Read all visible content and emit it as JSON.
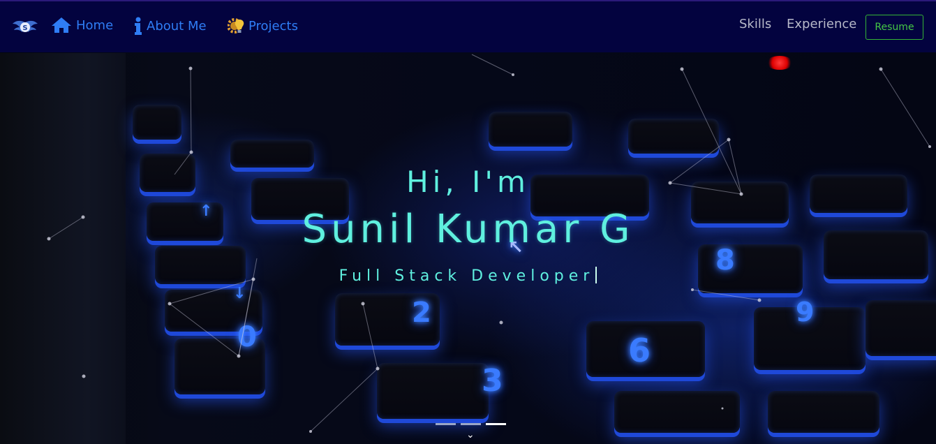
{
  "navbar": {
    "logo_icon": "winged-s-logo-icon",
    "items": [
      {
        "label": "Home",
        "icon": "home-icon"
      },
      {
        "label": "About Me",
        "icon": "info-icon"
      },
      {
        "label": "Projects",
        "icon": "lightbulb-gear-icon"
      }
    ],
    "right_items": [
      {
        "label": "Skills"
      },
      {
        "label": "Experience"
      }
    ],
    "resume_label": "Resume",
    "colors": {
      "background": "#03033f",
      "link": "#2f7df5",
      "resume": "#45c845"
    }
  },
  "hero": {
    "greeting": "Hi, I'm",
    "name": "Sunil Kumar G",
    "role": "Full Stack Developer",
    "text_color": "#5ff0df",
    "carousel": {
      "slides": 3,
      "active_index": 2
    },
    "scroll_icon": "chevron-down-icon"
  }
}
